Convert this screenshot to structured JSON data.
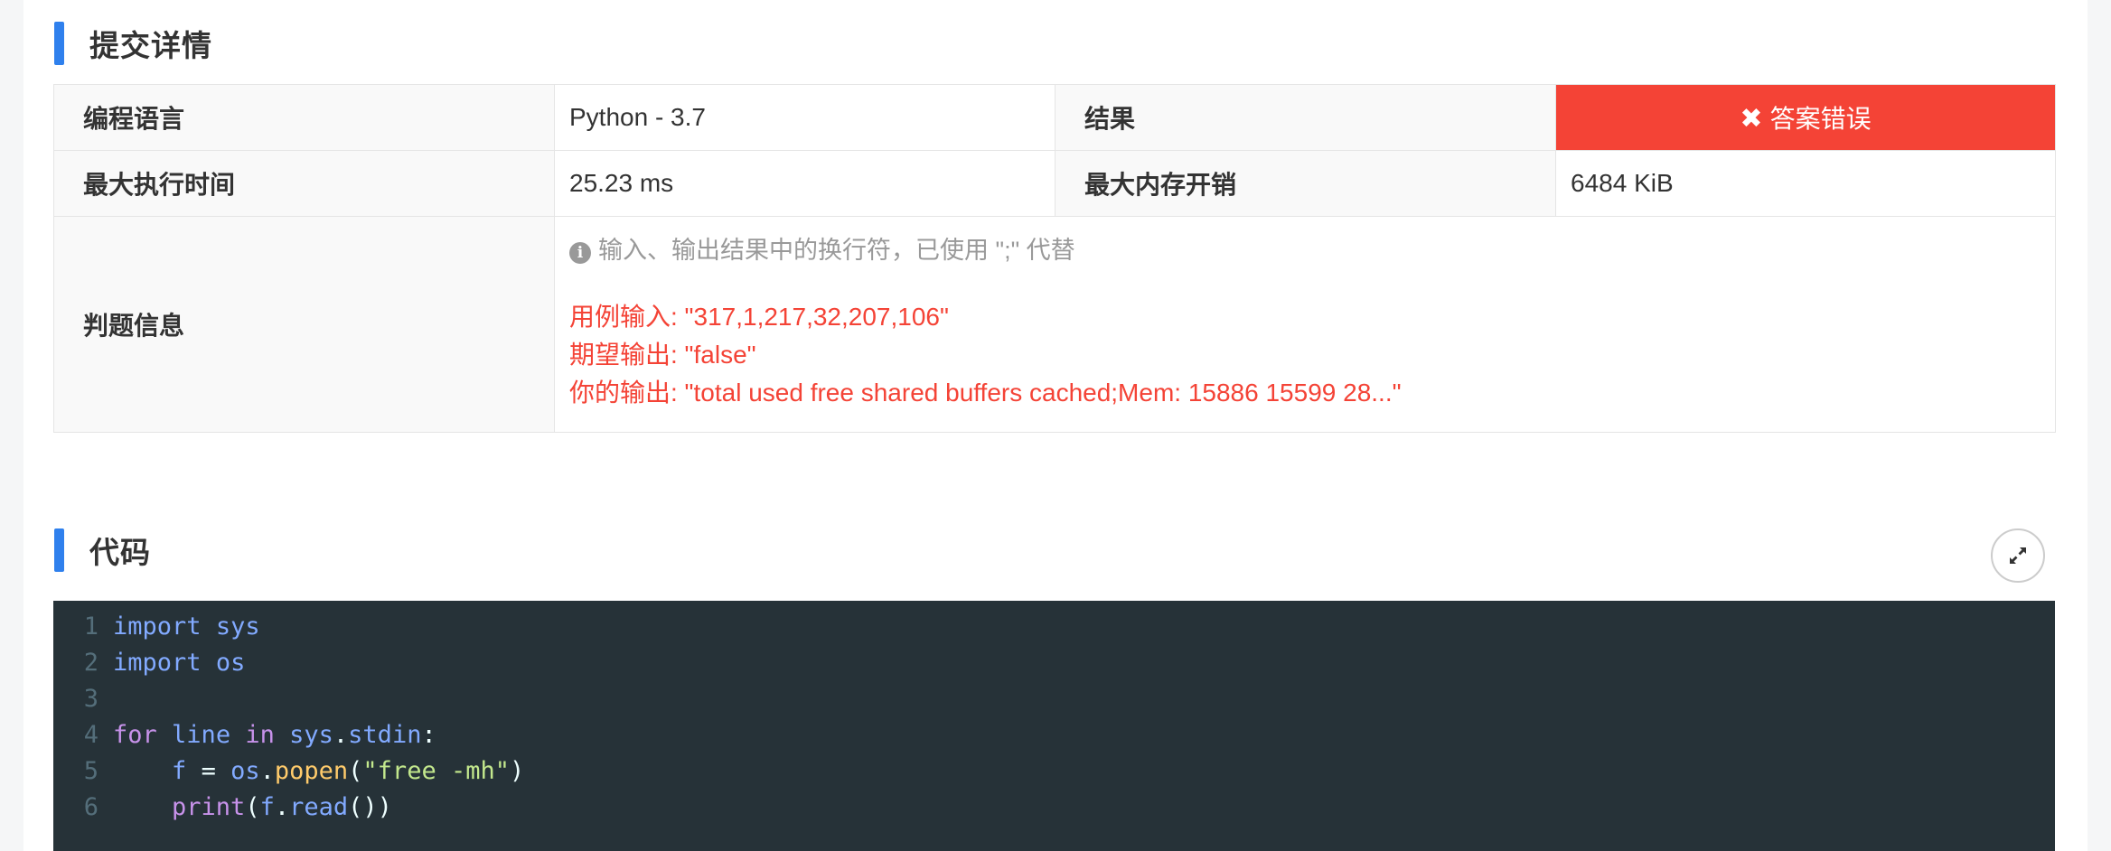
{
  "submission": {
    "section_title": "提交详情",
    "language_label": "编程语言",
    "language_value": "Python - 3.7",
    "result_label": "结果",
    "result_value": "答案错误",
    "time_label": "最大执行时间",
    "time_value": "25.23 ms",
    "memory_label": "最大内存开销",
    "memory_value": "6484 KiB",
    "judge_label": "判题信息",
    "judge_note": "输入、输出结果中的换行符，已使用 \";\" 代替",
    "judge_lines": [
      "用例输入: \"317,1,217,32,207,106\"",
      "期望输出: \"false\"",
      "你的输出: \"total used free shared buffers cached;Mem: 15886 15599 28...\""
    ],
    "colors": {
      "error": "#f44336",
      "accent": "#2f80ed",
      "code_bg": "#263238"
    }
  },
  "code": {
    "section_title": "代码",
    "expand_icon": "expand-icon",
    "line_numbers": [
      "1",
      "2",
      "3",
      "4",
      "5",
      "6"
    ],
    "tokens": {
      "l1": [
        "import",
        "sys"
      ],
      "l2": [
        "import",
        "os"
      ],
      "l4": [
        "for",
        "line",
        "in",
        "sys",
        ".",
        "stdin",
        ":"
      ],
      "l5": [
        "f",
        "=",
        "os",
        ".",
        "popen",
        "(",
        "\"free -mh\"",
        ")"
      ],
      "l6": [
        "print",
        "(",
        "f",
        ".",
        "read",
        "())"
      ]
    }
  }
}
